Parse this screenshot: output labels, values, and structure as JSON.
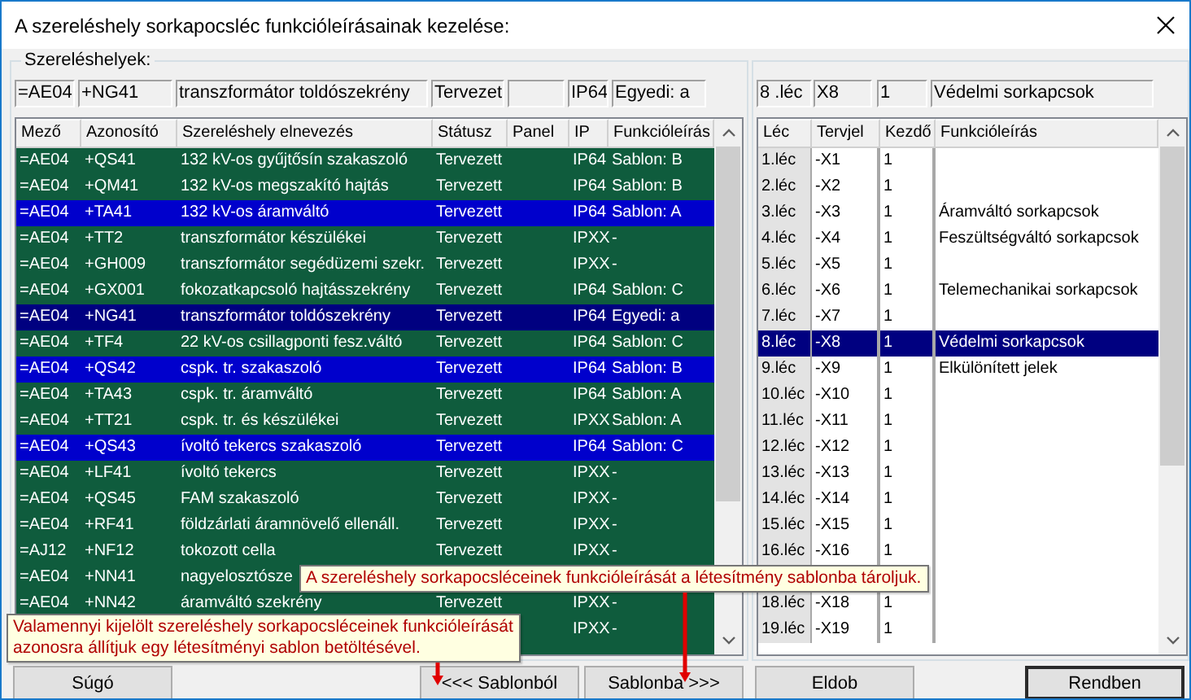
{
  "window": {
    "title": "A szereléshely sorkapocsléc funkcióleírásainak kezelése:"
  },
  "locations": {
    "label": "Szereléshelyek:",
    "fields": [
      {
        "kind": "text",
        "value": "=AE04"
      },
      {
        "kind": "text",
        "value": "+NG41"
      },
      {
        "kind": "text",
        "value": "transzformátor toldószekrény"
      },
      {
        "kind": "text",
        "value": "Tervezet"
      },
      {
        "kind": "empty"
      },
      {
        "kind": "text",
        "value": "IP64"
      },
      {
        "kind": "text",
        "value": "Egyedi: a"
      }
    ],
    "table": {
      "columns": [
        "Mező",
        "Azonosító",
        "Szereléshely elnevezés",
        "Státusz",
        "Panel",
        "IP",
        "Funkcióleírás"
      ],
      "rows": [
        {
          "field": "=AE04",
          "id": "+QS41",
          "name": "132 kV-os gyűjtősín szakaszoló",
          "status": "Tervezett",
          "ip": "IP64",
          "description": "Sablon: B",
          "selected": false,
          "current": false
        },
        {
          "field": "=AE04",
          "id": "+QM41",
          "name": "132 kV-os megszakító hajtás",
          "status": "Tervezett",
          "ip": "IP64",
          "description": "Sablon: B",
          "selected": false,
          "current": false
        },
        {
          "field": "=AE04",
          "id": "+TA41",
          "name": "132 kV-os áramváltó",
          "status": "Tervezett",
          "ip": "IP64",
          "description": "Sablon: A",
          "selected": true,
          "current": false
        },
        {
          "field": "=AE04",
          "id": "+TT2",
          "name": "transzformátor készülékei",
          "status": "Tervezett",
          "ip": "IPXX",
          "description": "-",
          "selected": false,
          "current": false
        },
        {
          "field": "=AE04",
          "id": "+GH009",
          "name": "transzformátor segédüzemi szekr.",
          "status": "Tervezett",
          "ip": "IPXX",
          "description": "-",
          "selected": false,
          "current": false
        },
        {
          "field": "=AE04",
          "id": "+GX001",
          "name": "fokozatkapcsoló hajtásszekrény",
          "status": "Tervezett",
          "ip": "IP64",
          "description": "Sablon: C",
          "selected": false,
          "current": false
        },
        {
          "field": "=AE04",
          "id": "+NG41",
          "name": "transzformátor toldószekrény",
          "status": "Tervezett",
          "ip": "IP64",
          "description": "Egyedi: a",
          "selected": true,
          "current": true
        },
        {
          "field": "=AE04",
          "id": "+TF4",
          "name": "22 kV-os csillagponti fesz.váltó",
          "status": "Tervezett",
          "ip": "IP64",
          "description": "Sablon: C",
          "selected": false,
          "current": false
        },
        {
          "field": "=AE04",
          "id": "+QS42",
          "name": "cspk. tr. szakaszoló",
          "status": "Tervezett",
          "ip": "IP64",
          "description": "Sablon: B",
          "selected": true,
          "current": false
        },
        {
          "field": "=AE04",
          "id": "+TA43",
          "name": "cspk. tr. áramváltó",
          "status": "Tervezett",
          "ip": "IP64",
          "description": "Sablon: A",
          "selected": false,
          "current": false
        },
        {
          "field": "=AE04",
          "id": "+TT21",
          "name": "cspk. tr. és készülékei",
          "status": "Tervezett",
          "ip": "IPXX",
          "description": "Sablon: A",
          "selected": false,
          "current": false
        },
        {
          "field": "=AE04",
          "id": "+QS43",
          "name": "ívoltó tekercs szakaszoló",
          "status": "Tervezett",
          "ip": "IP64",
          "description": "Sablon: C",
          "selected": true,
          "current": false
        },
        {
          "field": "=AE04",
          "id": "+LF41",
          "name": "ívoltó tekercs",
          "status": "Tervezett",
          "ip": "IPXX",
          "description": "-",
          "selected": false,
          "current": false
        },
        {
          "field": "=AE04",
          "id": "+QS45",
          "name": "FAM szakaszoló",
          "status": "Tervezett",
          "ip": "IPXX",
          "description": "-",
          "selected": false,
          "current": false
        },
        {
          "field": "=AE04",
          "id": "+RF41",
          "name": "földzárlati áramnövelő ellenáll.",
          "status": "Tervezett",
          "ip": "IPXX",
          "description": "-",
          "selected": false,
          "current": false
        },
        {
          "field": "=AJ12",
          "id": "+NF12",
          "name": "tokozott cella",
          "status": "Tervezett",
          "ip": "IPXX",
          "description": "-",
          "selected": false,
          "current": false
        },
        {
          "field": "=AE04",
          "id": "+NN41",
          "name": "nagyelosztósze",
          "selected": false,
          "current": false
        },
        {
          "field": "=AE04",
          "id": "+NN42",
          "name": "áramváltó szekrény",
          "status": "Tervezett",
          "ip": "IPXX",
          "description": "-",
          "selected": false,
          "current": false
        },
        {
          "ip": "IPXX",
          "description": "-",
          "selected": false,
          "current": false
        }
      ]
    }
  },
  "strips": {
    "fields": [
      {
        "kind": "text",
        "value": "8 .léc"
      },
      {
        "kind": "text",
        "value": "X8"
      },
      {
        "kind": "text",
        "value": "1"
      },
      {
        "kind": "text",
        "value": "Védelmi sorkapcsok"
      }
    ],
    "table": {
      "columns": [
        "Léc",
        "Tervjel",
        "Kezdő",
        "Funkcióleírás"
      ],
      "rows": [
        {
          "strip": "1.léc",
          "tag": "-X1",
          "start": "1",
          "selected": false
        },
        {
          "strip": "2.léc",
          "tag": "-X2",
          "start": "1",
          "selected": false
        },
        {
          "strip": "3.léc",
          "tag": "-X3",
          "start": "1",
          "description": "Áramváltó sorkapcsok",
          "selected": false
        },
        {
          "strip": "4.léc",
          "tag": "-X4",
          "start": "1",
          "description": "Feszültségváltó sorkapcsok",
          "selected": false
        },
        {
          "strip": "5.léc",
          "tag": "-X5",
          "start": "1",
          "selected": false
        },
        {
          "strip": "6.léc",
          "tag": "-X6",
          "start": "1",
          "description": "Telemechanikai sorkapcsok",
          "selected": false
        },
        {
          "strip": "7.léc",
          "tag": "-X7",
          "start": "1",
          "selected": false
        },
        {
          "strip": "8.léc",
          "tag": "-X8",
          "start": "1",
          "description": "Védelmi sorkapcsok",
          "selected": true
        },
        {
          "strip": "9.léc",
          "tag": "-X9",
          "start": "1",
          "description": "Elkülönített jelek",
          "selected": false
        },
        {
          "strip": "10.léc",
          "tag": "-X10",
          "start": "1",
          "selected": false
        },
        {
          "strip": "11.léc",
          "tag": "-X11",
          "start": "1",
          "selected": false
        },
        {
          "strip": "12.léc",
          "tag": "-X12",
          "start": "1",
          "selected": false
        },
        {
          "strip": "13.léc",
          "tag": "-X13",
          "start": "1",
          "selected": false
        },
        {
          "strip": "14.léc",
          "tag": "-X14",
          "start": "1",
          "selected": false
        },
        {
          "strip": "15.léc",
          "tag": "-X15",
          "start": "1",
          "selected": false
        },
        {
          "strip": "16.léc",
          "tag": "-X16",
          "start": "1",
          "selected": false
        },
        {
          "selected": false
        },
        {
          "strip": "18.léc",
          "tag": "-X18",
          "start": "1",
          "selected": false
        },
        {
          "strip": "19.léc",
          "tag": "-X19",
          "start": "1",
          "selected": false
        }
      ]
    }
  },
  "buttons": [
    {
      "label": "Súgó",
      "default": false
    },
    {
      "label": "<<< Sablonból",
      "default": false
    },
    {
      "label": "Sablonba >>>",
      "default": false
    },
    {
      "label": "Eldob",
      "default": false
    },
    {
      "label": "Rendben",
      "default": true
    }
  ],
  "tooltips": [
    {
      "lines": [
        "A szereléshely sorkapocsléceinek funkcióleírását a létesítmény sablonba tároljuk."
      ]
    },
    {
      "lines": [
        "Valamennyi kijelölt szereléshely sorkapocsléceinek funkcióleírását",
        "azonosra állítjuk egy létesítményi sablon betöltésével."
      ]
    }
  ]
}
